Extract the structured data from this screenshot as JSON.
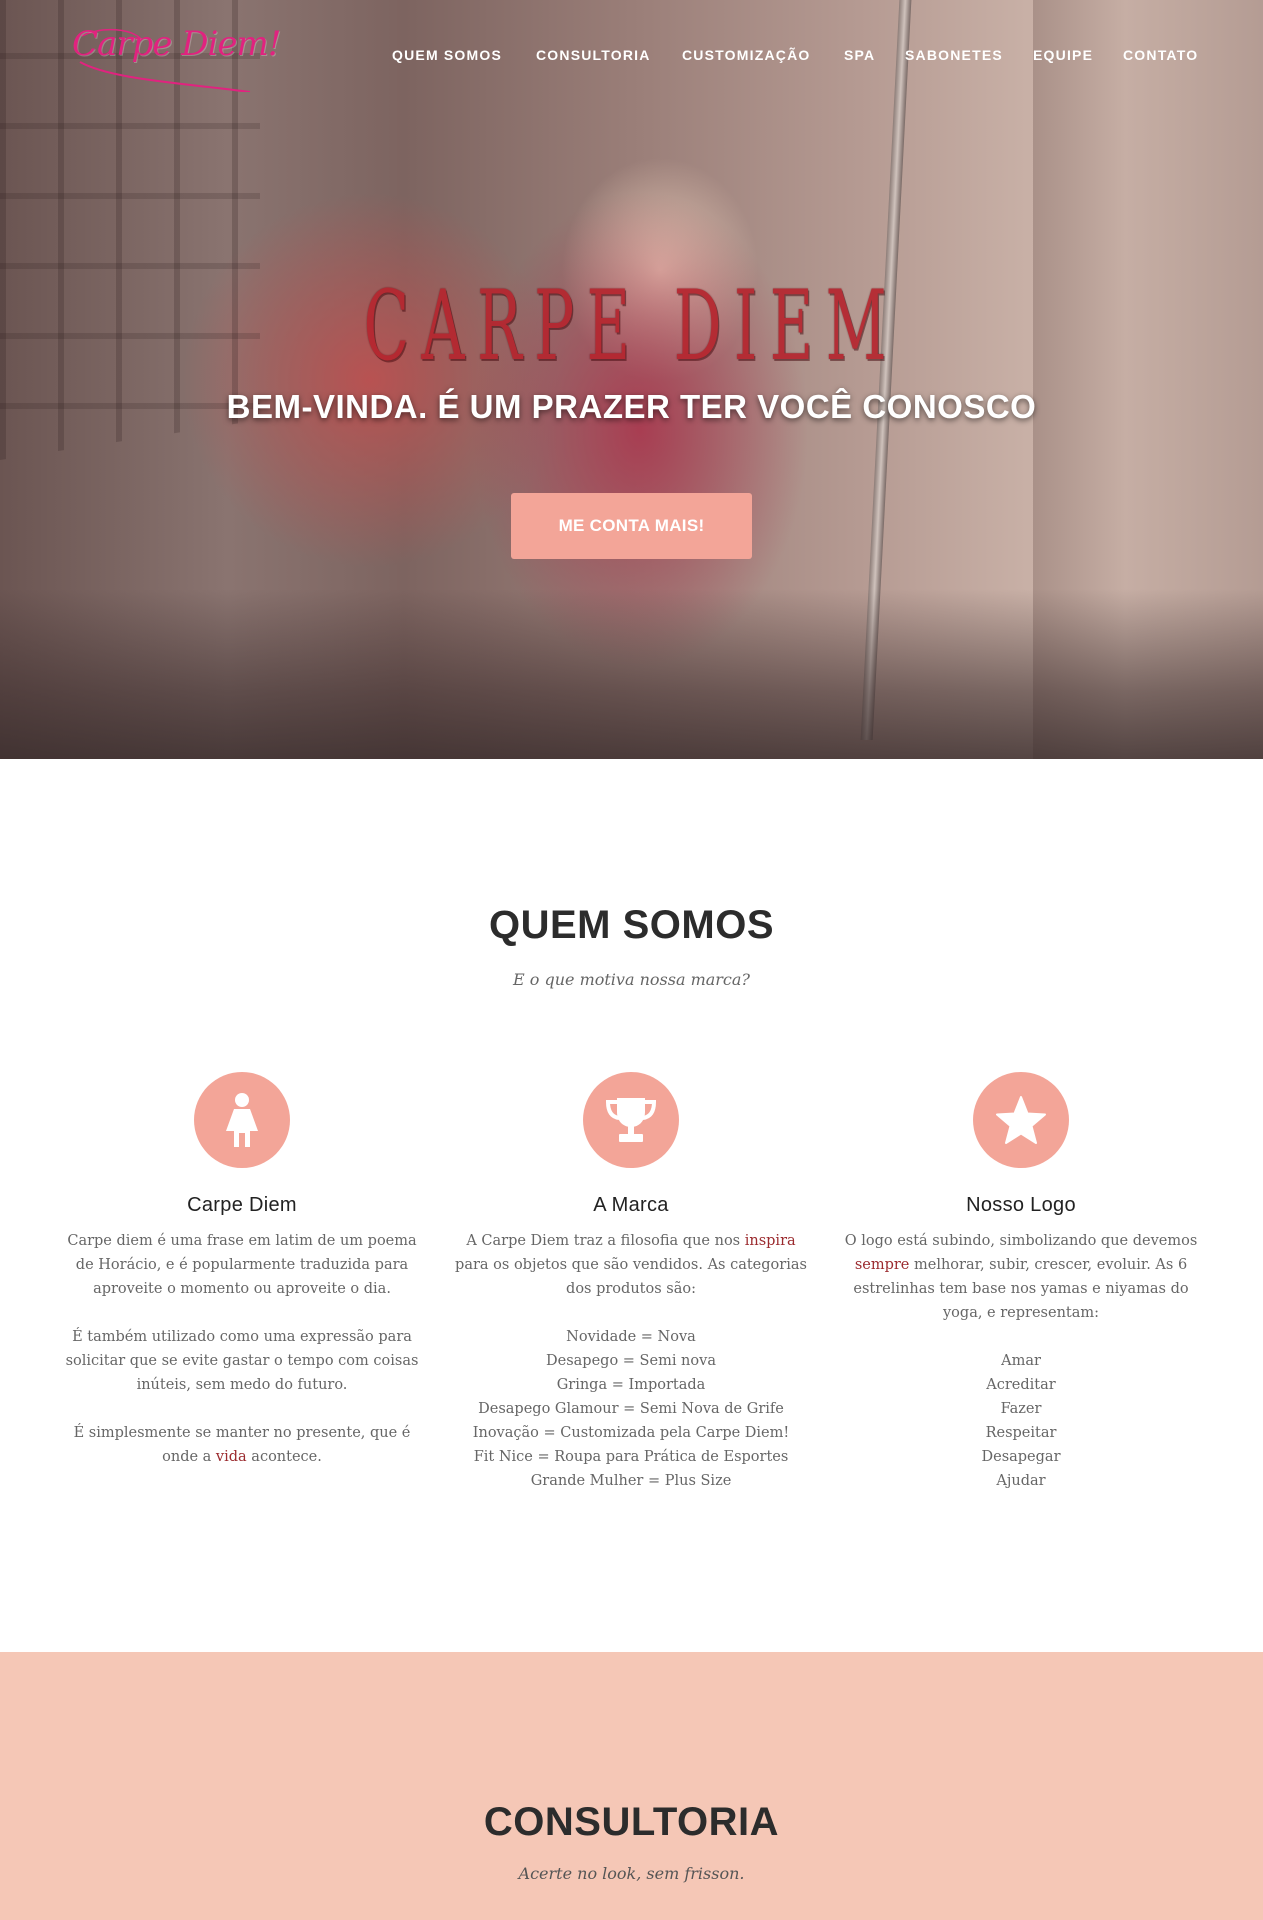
{
  "header": {
    "logo_text": "Carpe Diem!",
    "nav": [
      "QUEM SOMOS",
      "CONSULTORIA",
      "CUSTOMIZAÇÃO",
      "SPA",
      "SABONETES",
      "EQUIPE",
      "CONTATO"
    ]
  },
  "hero": {
    "brand": "CARPE DIEM",
    "tagline": "BEM-VINDA. É UM PRAZER TER VOCÊ CONOSCO",
    "cta_label": "ME CONTA MAIS!"
  },
  "about": {
    "title": "QUEM SOMOS",
    "subtitle": "E o que motiva nossa marca?",
    "features": [
      {
        "icon": "female-icon",
        "title": "Carpe Diem",
        "p1": "Carpe diem é uma frase em latim de um poema de Horácio, e é popularmente traduzida para aproveite o momento ou aproveite o dia.",
        "p2": "É também utilizado como uma expressão para solicitar que se evite gastar o tempo com coisas inúteis, sem medo do futuro.",
        "p3_before": "É simplesmente se manter no presente, que é onde a",
        "p3_highlight": "vida",
        "p3_after": "acontece."
      },
      {
        "icon": "trophy-icon",
        "title": "A Marca",
        "p1_before": "A Carpe Diem traz a filosofia que nos",
        "p1_highlight": "inspira",
        "p1_after": "para os objetos que são vendidos. As categorias dos produtos são:",
        "list": [
          "Novidade = Nova",
          "Desapego = Semi nova",
          "Gringa = Importada",
          "Desapego Glamour = Semi Nova de Grife",
          "Inovação = Customizada pela Carpe Diem!",
          "Fit Nice = Roupa para Prática de Esportes",
          "Grande Mulher = Plus Size"
        ]
      },
      {
        "icon": "star-icon",
        "title": "Nosso Logo",
        "p1_before": "O logo está subindo, simbolizando que devemos",
        "p1_highlight": "sempre",
        "p1_after": "melhorar, subir, crescer, evoluir. As 6 estrelinhas tem base nos yamas e niyamas do yoga, e representam:",
        "list": [
          "Amar",
          "Acreditar",
          "Fazer",
          "Respeitar",
          "Desapegar",
          "Ajudar"
        ]
      }
    ]
  },
  "consultoria": {
    "title": "CONSULTORIA",
    "subtitle": "Acerte no look, sem frisson."
  },
  "colors": {
    "accent": "#f3a598",
    "section_bg": "#f5c7b6",
    "highlight": "#9b2a2e",
    "logo": "#e0237f"
  }
}
